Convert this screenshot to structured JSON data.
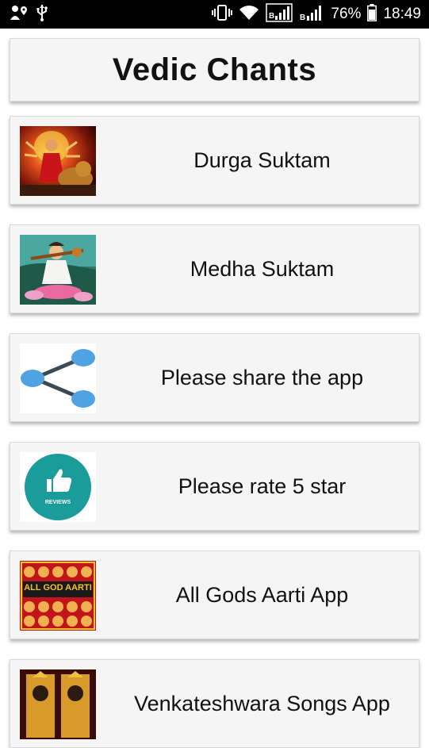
{
  "status_bar": {
    "battery_percent": "76%",
    "time": "18:49",
    "icons": [
      "location-person-icon",
      "usb-icon",
      "vibrate-icon",
      "wifi-icon",
      "signal-icon",
      "signal-icon",
      "battery-icon"
    ]
  },
  "app": {
    "title": "Vedic Chants"
  },
  "items": [
    {
      "label": "Durga Suktam",
      "icon": "durga-image"
    },
    {
      "label": "Medha Suktam",
      "icon": "saraswati-image"
    },
    {
      "label": "Please share the app",
      "icon": "share-icon"
    },
    {
      "label": "Please rate 5 star",
      "icon": "reviews-thumbs-up-icon",
      "icon_text": "REVIEWS"
    },
    {
      "label": "All Gods Aarti App",
      "icon": "all-god-aarti-image",
      "icon_text": "ALL GOD AARTI"
    },
    {
      "label": "Venkateshwara Songs App",
      "icon": "venkateshwara-image"
    }
  ],
  "colors": {
    "status_bar_bg": "#000000",
    "card_bg": "#f5f5f5",
    "share_blue": "#4fa3e3",
    "reviews_teal": "#1a9c9a",
    "aarti_yellow": "#f2c12e",
    "aarti_red": "#c0151a"
  }
}
